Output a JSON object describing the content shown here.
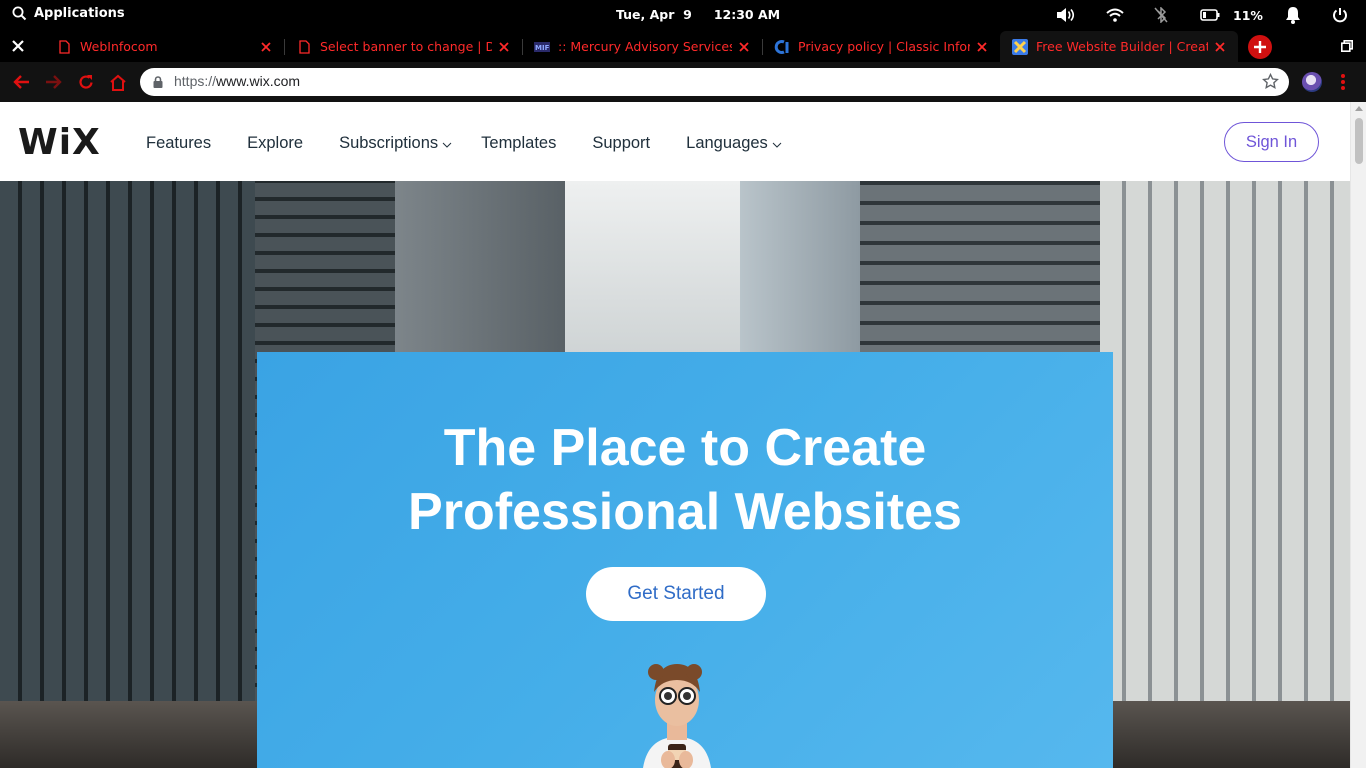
{
  "os_bar": {
    "apps_label": "Applications",
    "date": "Tue, Apr  9",
    "time": "12:30 AM",
    "battery_pct": "11%"
  },
  "tabs": [
    {
      "title": "WebInfocom",
      "favicon": "page-icon"
    },
    {
      "title": "Select banner to change | Django",
      "favicon": "page-icon"
    },
    {
      "title": ":: Mercury Advisory Services Pvt",
      "favicon": "mifs-icon"
    },
    {
      "title": "Privacy policy | Classic Informatics",
      "favicon": "ci-icon"
    },
    {
      "title": "Free Website Builder | Create a Free",
      "favicon": "wix-icon"
    }
  ],
  "address_bar": {
    "scheme": "https://",
    "host": "www.wix.com"
  },
  "site": {
    "logo": "WiX",
    "menu": [
      "Features",
      "Explore",
      "Subscriptions",
      "Templates",
      "Support",
      "Languages"
    ],
    "sign_in": "Sign In",
    "hero_line1": "The Place to Create",
    "hero_line2": "Professional Websites",
    "cta": "Get Started"
  },
  "colors": {
    "tab_text": "#ff2a2a",
    "accent": "#6f55d8",
    "hero_card": "#45aee9",
    "cta_text": "#2f6cc7"
  }
}
